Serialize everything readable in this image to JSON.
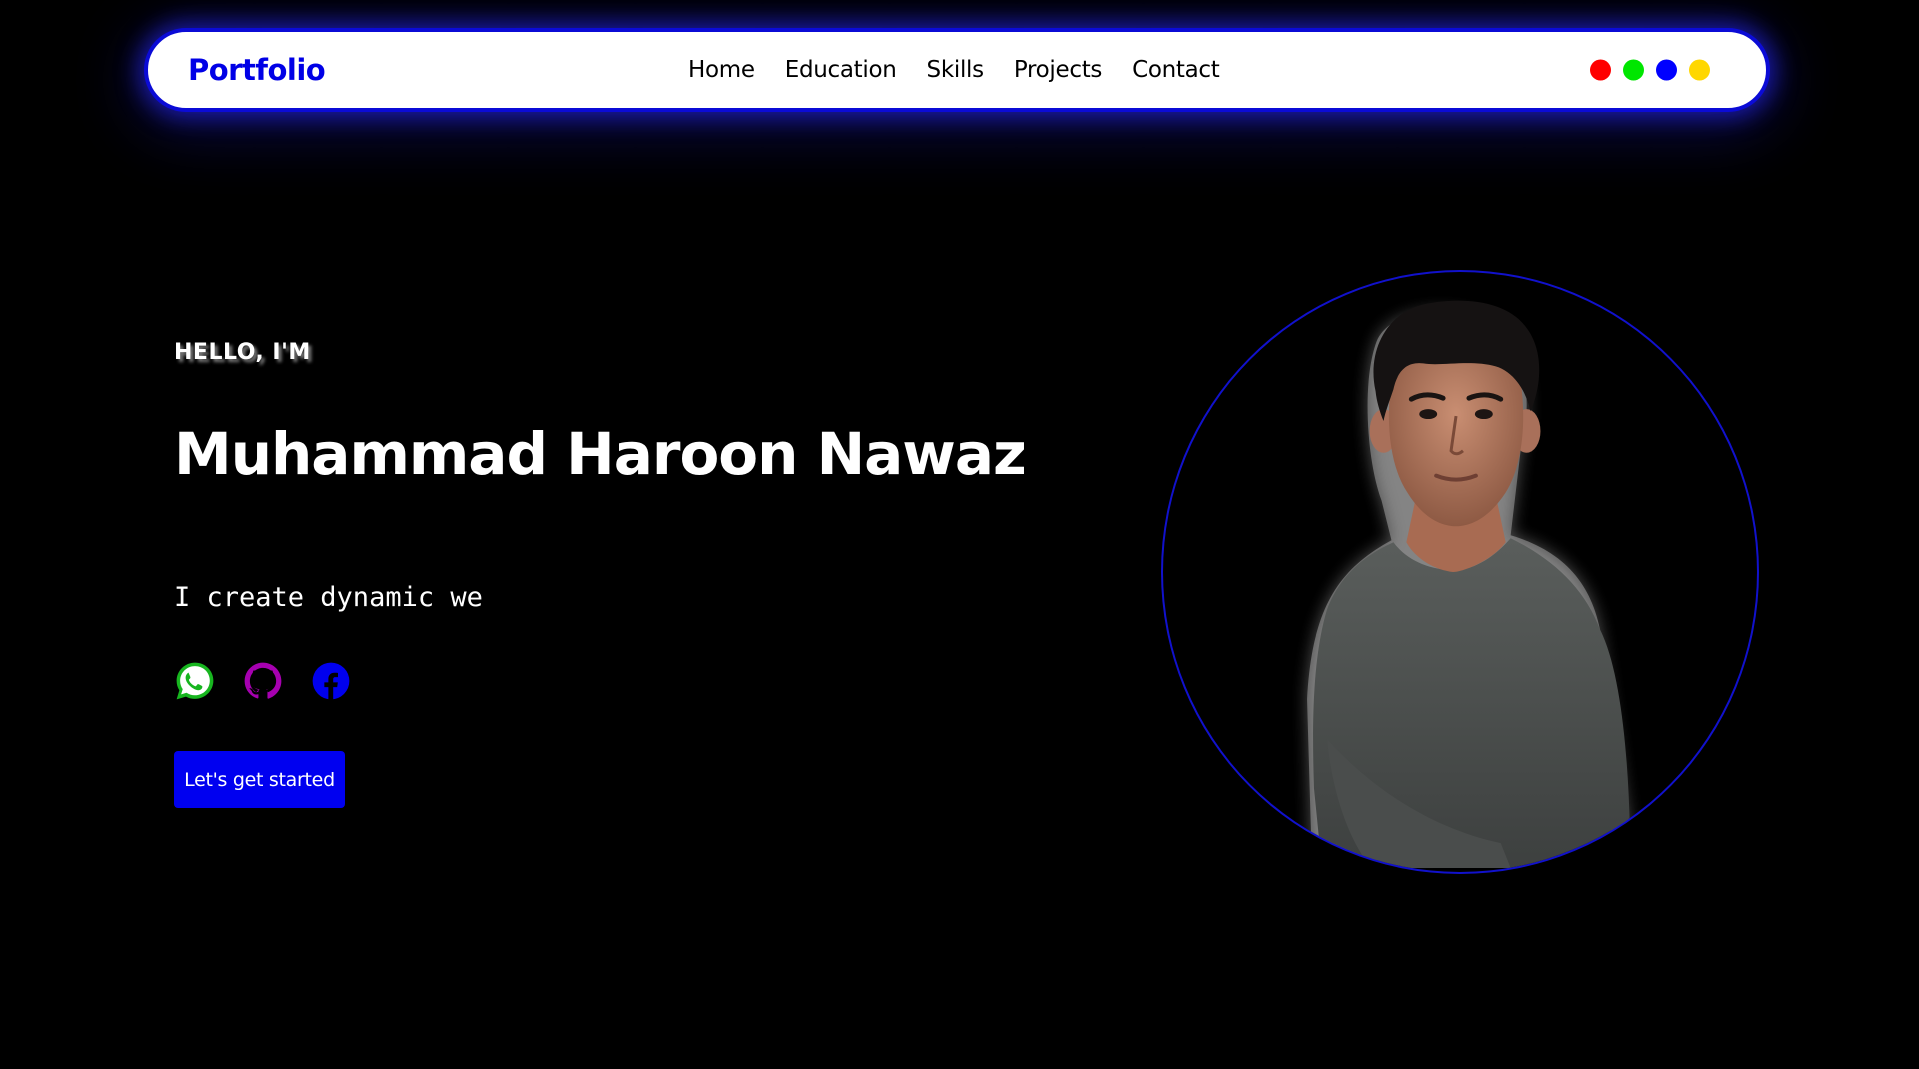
{
  "navbar": {
    "brand": "Portfolio",
    "links": [
      "Home",
      "Education",
      "Skills",
      "Projects",
      "Contact"
    ],
    "theme_colors": [
      "#ff0000",
      "#00e600",
      "#0000ff",
      "#ffd700"
    ]
  },
  "hero": {
    "greeting": "HELLO, I'M",
    "name": "Muhammad Haroon Nawaz",
    "typed_text": "I create dynamic we",
    "socials": [
      {
        "icon": "whatsapp-icon",
        "color": "#17b51f"
      },
      {
        "icon": "github-icon",
        "color": "#a600b0"
      },
      {
        "icon": "facebook-icon",
        "color": "#0000ee"
      }
    ],
    "cta_label": "Let's get started"
  },
  "colors": {
    "background": "#000000",
    "accent": "#0000f0",
    "brand": "#0000e6",
    "ring": "#1111cc"
  }
}
